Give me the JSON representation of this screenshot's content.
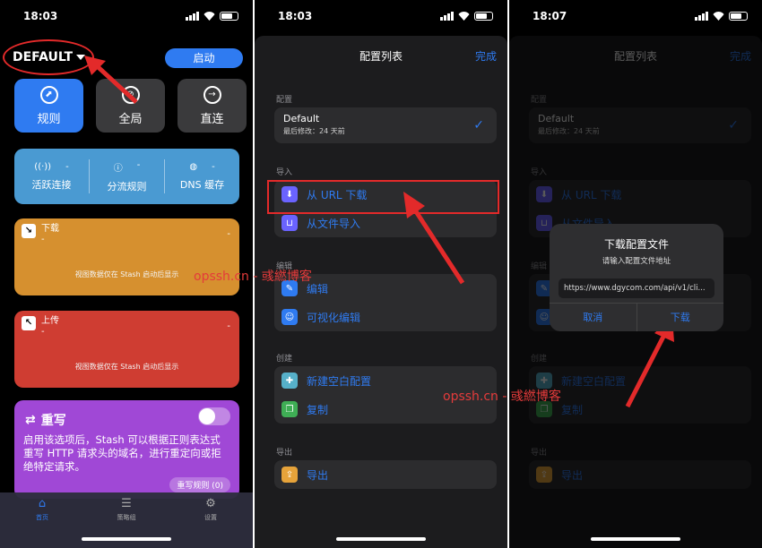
{
  "screens": [
    {
      "status_time": "18:03",
      "profile_name": "DEFAULT",
      "start_label": "启动",
      "modes": [
        {
          "label": "规则",
          "icon": "compass-icon",
          "active": true
        },
        {
          "label": "全局",
          "icon": "globe-crossed-icon",
          "active": false
        },
        {
          "label": "直连",
          "icon": "arrow-right-circle-icon",
          "active": false
        }
      ],
      "stats": [
        {
          "label": "活跃连接",
          "value": "-"
        },
        {
          "label": "分流规则",
          "value": "-"
        },
        {
          "label": "DNS 缓存",
          "value": "-"
        }
      ],
      "download": {
        "title": "下载",
        "sub": "-",
        "dash": "-",
        "message": "视图数据仅在 Stash 启动后显示"
      },
      "upload": {
        "title": "上传",
        "sub": "-",
        "dash": "-",
        "message": "视图数据仅在 Stash 启动后显示"
      },
      "rewrite": {
        "title": "重写",
        "desc": "启用该选项后，Stash 可以根据正则表达式重写 HTTP 请求头的域名，进行重定向或拒绝特定请求。",
        "button": "重写规则 (0)"
      },
      "tabs": [
        {
          "label": "首页",
          "icon": "house-icon",
          "active": true
        },
        {
          "label": "策略组",
          "icon": "sliders-icon",
          "active": false
        },
        {
          "label": "设置",
          "icon": "gear-icon",
          "active": false
        }
      ]
    },
    {
      "status_time": "18:03",
      "title": "配置列表",
      "done": "完成",
      "sections": {
        "config": "配置",
        "import": "导入",
        "edit": "编辑",
        "create": "创建",
        "export": "导出"
      },
      "default_name": "Default",
      "default_sub": "最后修改：24 天前",
      "import_items": [
        "从 URL 下载",
        "从文件导入"
      ],
      "edit_items": [
        "编辑",
        "可视化编辑"
      ],
      "create_items": [
        "新建空白配置",
        "复制"
      ],
      "export_items": [
        "导出"
      ]
    },
    {
      "status_time": "18:07",
      "alert": {
        "title": "下载配置文件",
        "subtitle": "请输入配置文件地址",
        "input": "https://www.dgycom.com/api/v1/cli...",
        "cancel": "取消",
        "confirm": "下载"
      }
    }
  ],
  "watermark": "opssh.cn - 彧繎博客"
}
